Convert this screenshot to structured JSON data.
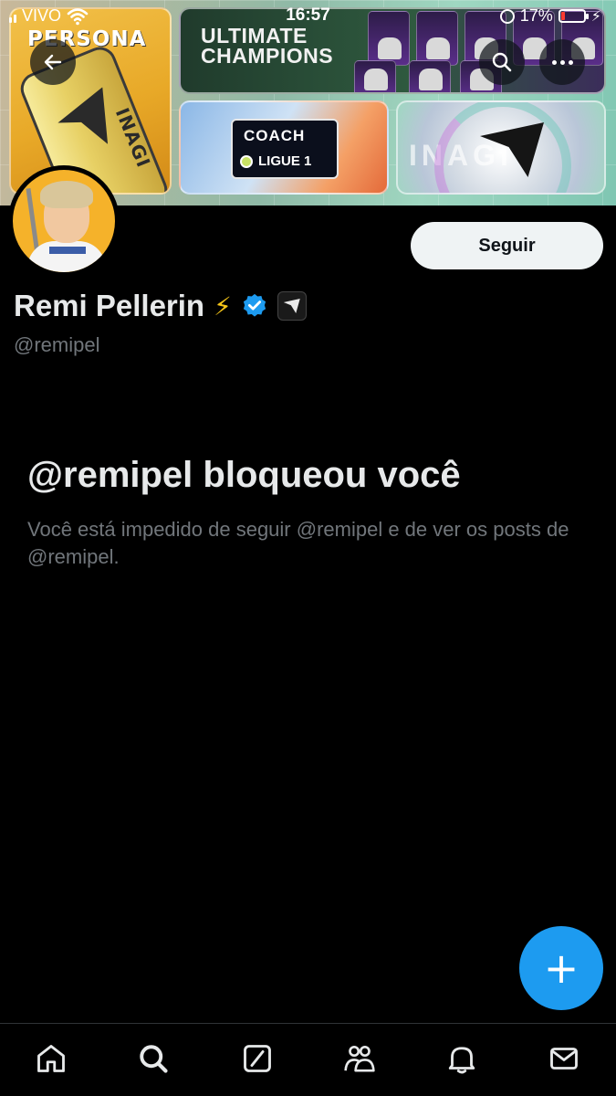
{
  "status_bar": {
    "carrier": "VIVO",
    "time": "16:57",
    "battery_percent": "17%",
    "battery_level": 0.17
  },
  "banner": {
    "persona_text": "PERSONA",
    "can_text": "INAGI",
    "ultimate_line1": "ULTIMATE",
    "ultimate_line2": "CHAMPIONS",
    "coach_text": "COACH",
    "ligue_text": "LIGUE 1",
    "shield_text": "INAGI"
  },
  "profile": {
    "display_name": "Remi Pellerin",
    "emoji": "⚡",
    "handle": "@remipel",
    "follow_label": "Seguir"
  },
  "blocked": {
    "title": "@remipel bloqueou você",
    "description": "Você está impedido de seguir @remipel e de ver os posts de @remipel."
  },
  "fab": {
    "label": "+"
  },
  "colors": {
    "accent": "#1d9bf0",
    "background": "#000000",
    "text_primary": "#e7e9ea",
    "text_secondary": "#71767b"
  },
  "icons": {
    "back": "arrow-left-icon",
    "search": "search-icon",
    "more": "more-icon",
    "verified": "verified-badge-icon",
    "nav": [
      "home-icon",
      "search-icon",
      "grok-icon",
      "communities-icon",
      "notifications-icon",
      "messages-icon"
    ]
  }
}
